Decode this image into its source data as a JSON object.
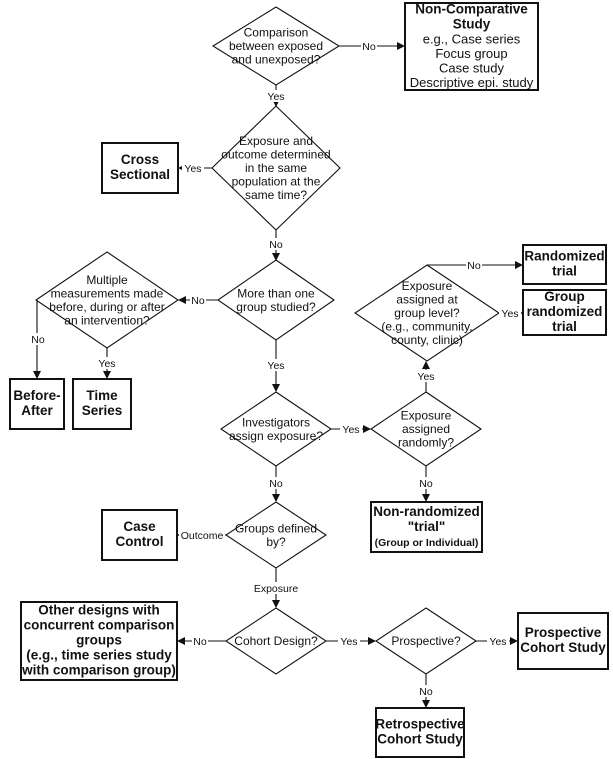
{
  "decisions": {
    "comparison": {
      "lines": [
        "Comparison",
        "between exposed",
        "and unexposed?"
      ]
    },
    "same_time": {
      "lines": [
        "Exposure and",
        "outcome determined",
        "in the same",
        "population at the",
        "same time?"
      ]
    },
    "more_groups": {
      "lines": [
        "More than one",
        "group studied?"
      ]
    },
    "multiple_measurements": {
      "lines": [
        "Multiple",
        "measurements made",
        "before, during or after",
        "an intervention?"
      ]
    },
    "investigators_assign": {
      "lines": [
        "Investigators",
        "assign exposure?"
      ]
    },
    "assigned_randomly": {
      "lines": [
        "Exposure",
        "assigned",
        "randomly?"
      ]
    },
    "group_level": {
      "lines": [
        "Exposure",
        "assigned at",
        "group level?",
        "(e.g., community,",
        "county, clinic)"
      ]
    },
    "groups_defined": {
      "lines": [
        "Groups defined",
        "by?"
      ]
    },
    "cohort_design": {
      "lines": [
        "Cohort Design?"
      ]
    },
    "prospective": {
      "lines": [
        "Prospective?"
      ]
    }
  },
  "outcomes": {
    "non_comparative": {
      "title": [
        "Non-Comparative",
        "Study"
      ],
      "lines": [
        "e.g., Case series",
        "Focus group",
        "Case study",
        "Descriptive epi. study"
      ]
    },
    "cross_sectional": {
      "title": [
        "Cross",
        "Sectional"
      ]
    },
    "before_after": {
      "title": [
        "Before-",
        "After"
      ]
    },
    "time_series": {
      "title": [
        "Time",
        "Series"
      ]
    },
    "randomized_trial": {
      "title": [
        "Randomized",
        "trial"
      ]
    },
    "group_randomized_trial": {
      "title": [
        "Group",
        "randomized",
        "trial"
      ]
    },
    "non_randomized_trial": {
      "title": [
        "Non-randomized",
        "\"trial\""
      ],
      "sub": "(Group or Individual)"
    },
    "case_control": {
      "title": [
        "Case",
        "Control"
      ]
    },
    "other_designs": {
      "title": [
        "Other designs with",
        "concurrent comparison",
        "groups",
        "(e.g., time series study",
        "with comparison group)"
      ]
    },
    "prospective_cohort": {
      "title": [
        "Prospective",
        "Cohort Study"
      ]
    },
    "retrospective_cohort": {
      "title": [
        "Retrospective",
        "Cohort Study"
      ]
    }
  },
  "edges": [
    {
      "from": "comparison",
      "to": "non_comparative",
      "label": "No"
    },
    {
      "from": "comparison",
      "to": "same_time",
      "label": "Yes"
    },
    {
      "from": "same_time",
      "to": "cross_sectional",
      "label": "Yes"
    },
    {
      "from": "same_time",
      "to": "more_groups",
      "label": "No"
    },
    {
      "from": "more_groups",
      "to": "multiple_measurements",
      "label": "No"
    },
    {
      "from": "multiple_measurements",
      "to": "before_after",
      "label": "No"
    },
    {
      "from": "multiple_measurements",
      "to": "time_series",
      "label": "Yes"
    },
    {
      "from": "more_groups",
      "to": "investigators_assign",
      "label": "Yes"
    },
    {
      "from": "investigators_assign",
      "to": "assigned_randomly",
      "label": "Yes"
    },
    {
      "from": "assigned_randomly",
      "to": "group_level",
      "label": "Yes"
    },
    {
      "from": "group_level",
      "to": "randomized_trial",
      "label": "No"
    },
    {
      "from": "group_level",
      "to": "group_randomized_trial",
      "label": "Yes"
    },
    {
      "from": "assigned_randomly",
      "to": "non_randomized_trial",
      "label": "No"
    },
    {
      "from": "investigators_assign",
      "to": "groups_defined",
      "label": "No"
    },
    {
      "from": "groups_defined",
      "to": "case_control",
      "label": "Outcome"
    },
    {
      "from": "groups_defined",
      "to": "cohort_design",
      "label": "Exposure"
    },
    {
      "from": "cohort_design",
      "to": "other_designs",
      "label": "No"
    },
    {
      "from": "cohort_design",
      "to": "prospective",
      "label": "Yes"
    },
    {
      "from": "prospective",
      "to": "prospective_cohort",
      "label": "Yes"
    },
    {
      "from": "prospective",
      "to": "retrospective_cohort",
      "label": "No"
    }
  ]
}
